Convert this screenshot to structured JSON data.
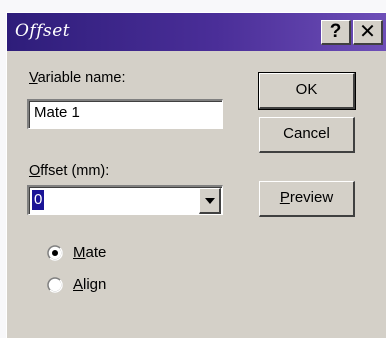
{
  "dialog": {
    "title": "Offset",
    "help_button": "?",
    "close_button": "✕"
  },
  "variable_name": {
    "label_prefix": "V",
    "label_rest": "ariable name:",
    "value": "Mate 1"
  },
  "offset": {
    "label_prefix": "O",
    "label_rest": "ffset (mm):",
    "value": "0"
  },
  "buttons": {
    "ok": "OK",
    "cancel": "Cancel",
    "preview_prefix": "P",
    "preview_rest": "review"
  },
  "mode": {
    "options": [
      {
        "prefix": "M",
        "rest": "ate",
        "selected": true
      },
      {
        "prefix": "A",
        "rest": "lign",
        "selected": false
      }
    ]
  },
  "colors": {
    "titlebar_start": "#2e1d7a",
    "titlebar_end": "#6e4fb8",
    "dialog_face": "#d4d0c8",
    "selection": "#1a1496"
  }
}
